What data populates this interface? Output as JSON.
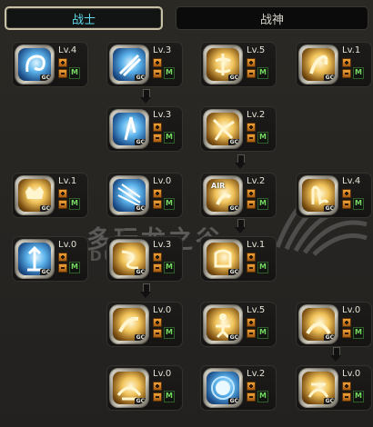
{
  "tabs": [
    {
      "label": "战士",
      "active": true
    },
    {
      "label": "战神",
      "active": false
    }
  ],
  "watermark": {
    "name": "多玩龙之谷",
    "url": "N.DU...OM"
  },
  "skills": [
    {
      "id": "r1c1",
      "level": "Lv.4",
      "color": "blue",
      "glyph": "swirl"
    },
    {
      "id": "r1c2",
      "level": "Lv.3",
      "color": "blue",
      "glyph": "slash"
    },
    {
      "id": "r1c3",
      "level": "Lv.5",
      "color": "gold",
      "glyph": "rune"
    },
    {
      "id": "r1c4",
      "level": "Lv.1",
      "color": "gold",
      "glyph": "leap"
    },
    {
      "id": "r2c2",
      "level": "Lv.3",
      "color": "blue",
      "glyph": "blade"
    },
    {
      "id": "r2c3",
      "level": "Lv.2",
      "color": "gold",
      "glyph": "burst"
    },
    {
      "id": "r3c1",
      "level": "Lv.1",
      "color": "gold",
      "glyph": "crown"
    },
    {
      "id": "r3c2",
      "level": "Lv.0",
      "color": "blue",
      "glyph": "streak"
    },
    {
      "id": "r3c3",
      "level": "Lv.2",
      "color": "gold",
      "glyph": "air",
      "badge": "AIR"
    },
    {
      "id": "r3c4",
      "level": "Lv.4",
      "color": "gold",
      "glyph": "hand"
    },
    {
      "id": "r4c1",
      "level": "Lv.0",
      "color": "blue",
      "glyph": "rise"
    },
    {
      "id": "r4c2",
      "level": "Lv.3",
      "color": "gold",
      "glyph": "spin"
    },
    {
      "id": "r4c3",
      "level": "Lv.1",
      "color": "gold",
      "glyph": "stomp"
    },
    {
      "id": "r5c2",
      "level": "Lv.0",
      "color": "gold",
      "glyph": "kick"
    },
    {
      "id": "r5c3",
      "level": "Lv.5",
      "color": "gold",
      "glyph": "figure"
    },
    {
      "id": "r5c4",
      "level": "Lv.0",
      "color": "gold",
      "glyph": "hp"
    },
    {
      "id": "r6c2",
      "level": "Lv.0",
      "color": "gold",
      "glyph": "hp2"
    },
    {
      "id": "r6c3",
      "level": "Lv.2",
      "color": "blue",
      "glyph": "orb"
    },
    {
      "id": "r6c4",
      "level": "Lv.0",
      "color": "gold",
      "glyph": "mp"
    }
  ],
  "labels": {
    "gc": "GC",
    "m": "M"
  },
  "colors": {
    "active_tab_text": "#5fd7e8",
    "level_text": "#e6e2d6",
    "m_text": "#74d860",
    "plus_minus": "#f0a33a"
  }
}
